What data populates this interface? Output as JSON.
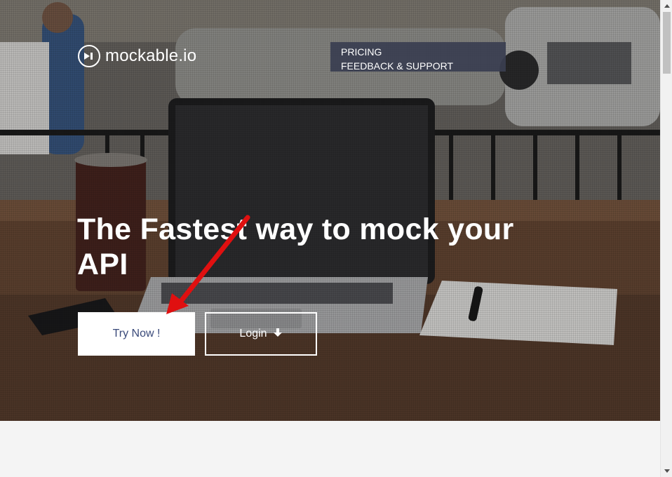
{
  "brand": {
    "name": "mockable.io"
  },
  "nav": {
    "items": [
      {
        "label": "PRICING"
      },
      {
        "label": "FEEDBACK & SUPPORT"
      }
    ]
  },
  "hero": {
    "headline": "The Fastest way to mock your API",
    "try_label": "Try Now !",
    "login_label": "Login"
  },
  "icons": {
    "logo": "play-next-icon",
    "login": "arrow-down-icon",
    "annotation": "red-arrow-icon"
  },
  "colors": {
    "nav_bg": "#3a3e50",
    "try_text": "#3a4a7a",
    "annotation": "#e01010"
  }
}
